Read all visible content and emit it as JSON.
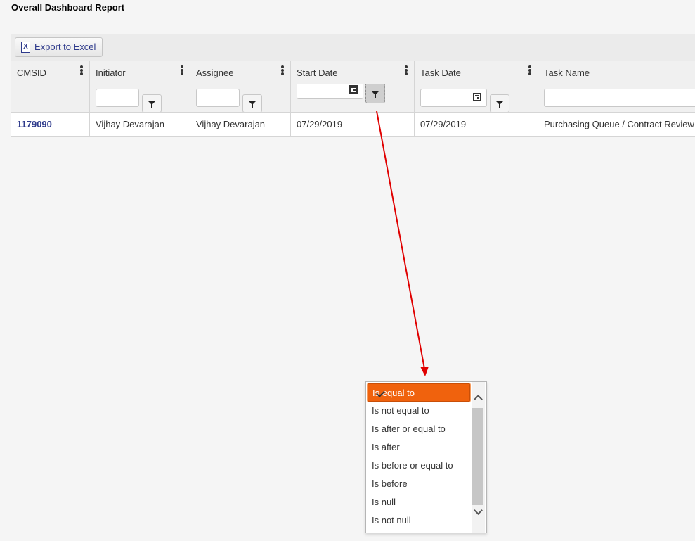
{
  "page": {
    "title": "Overall Dashboard Report"
  },
  "toolbar": {
    "export_label": "Export to Excel",
    "export_icon": "excel-icon"
  },
  "columns": [
    {
      "label": "CMSID"
    },
    {
      "label": "Initiator"
    },
    {
      "label": "Assignee"
    },
    {
      "label": "Start Date"
    },
    {
      "label": "Task Date"
    },
    {
      "label": "Task Name"
    }
  ],
  "row": {
    "cmsid": "1179090",
    "initiator": "Vijhay Devarajan",
    "assignee": "Vijhay Devarajan",
    "start_date": "07/29/2019",
    "task_date": "07/29/2019",
    "task_name": "Purchasing Queue / Contract Review"
  },
  "filter_menu": {
    "options": [
      "Is equal to",
      "Is not equal to",
      "Is after or equal to",
      "Is after",
      "Is before or equal to",
      "Is before",
      "Is null",
      "Is not null"
    ],
    "selected_index": 0
  },
  "colors": {
    "accent": "#f0620d",
    "link": "#2e3a8c",
    "annotation_arrow": "#e00000"
  }
}
